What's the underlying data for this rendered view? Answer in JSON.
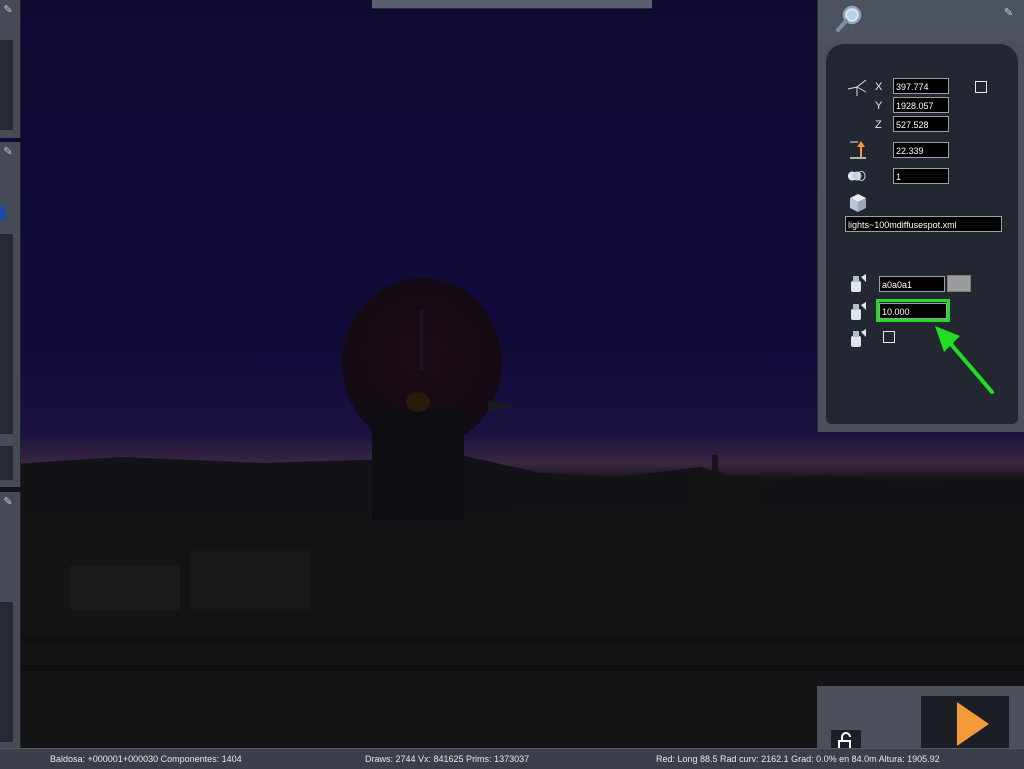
{
  "panel": {
    "x_label": "X",
    "y_label": "Y",
    "z_label": "Z",
    "x_value": "397.774",
    "y_value": "1928.057",
    "z_value": "527.528",
    "height_value": "22.339",
    "count_value": "1",
    "object_file": "lights~100mdiffusespot.xml",
    "color_value": "a0a0a1",
    "color_swatch": "#9c9c9c",
    "intensity_value": "10.000"
  },
  "status": {
    "tile": "Baldosa: +000001+000030  Componentes: 1404",
    "draws": "Draws: 2744 Vx: 841625 Prims: 1373037",
    "red": "Red:  Long  88.5 Rad  curv: 2162.1 Grad:  0.0% en 84.0m Altura: 1905.92"
  },
  "icons": {
    "magnifier": "magnifier-icon",
    "axes": "axes-icon",
    "height": "height-arrow-icon",
    "count": "count-icon",
    "cube": "cube-icon",
    "light": "spotlight-icon",
    "play": "play-icon",
    "lock": "unlock-icon",
    "pin": "pin-icon"
  },
  "colors": {
    "highlight": "#22dd22",
    "play": "#f59a3a"
  }
}
